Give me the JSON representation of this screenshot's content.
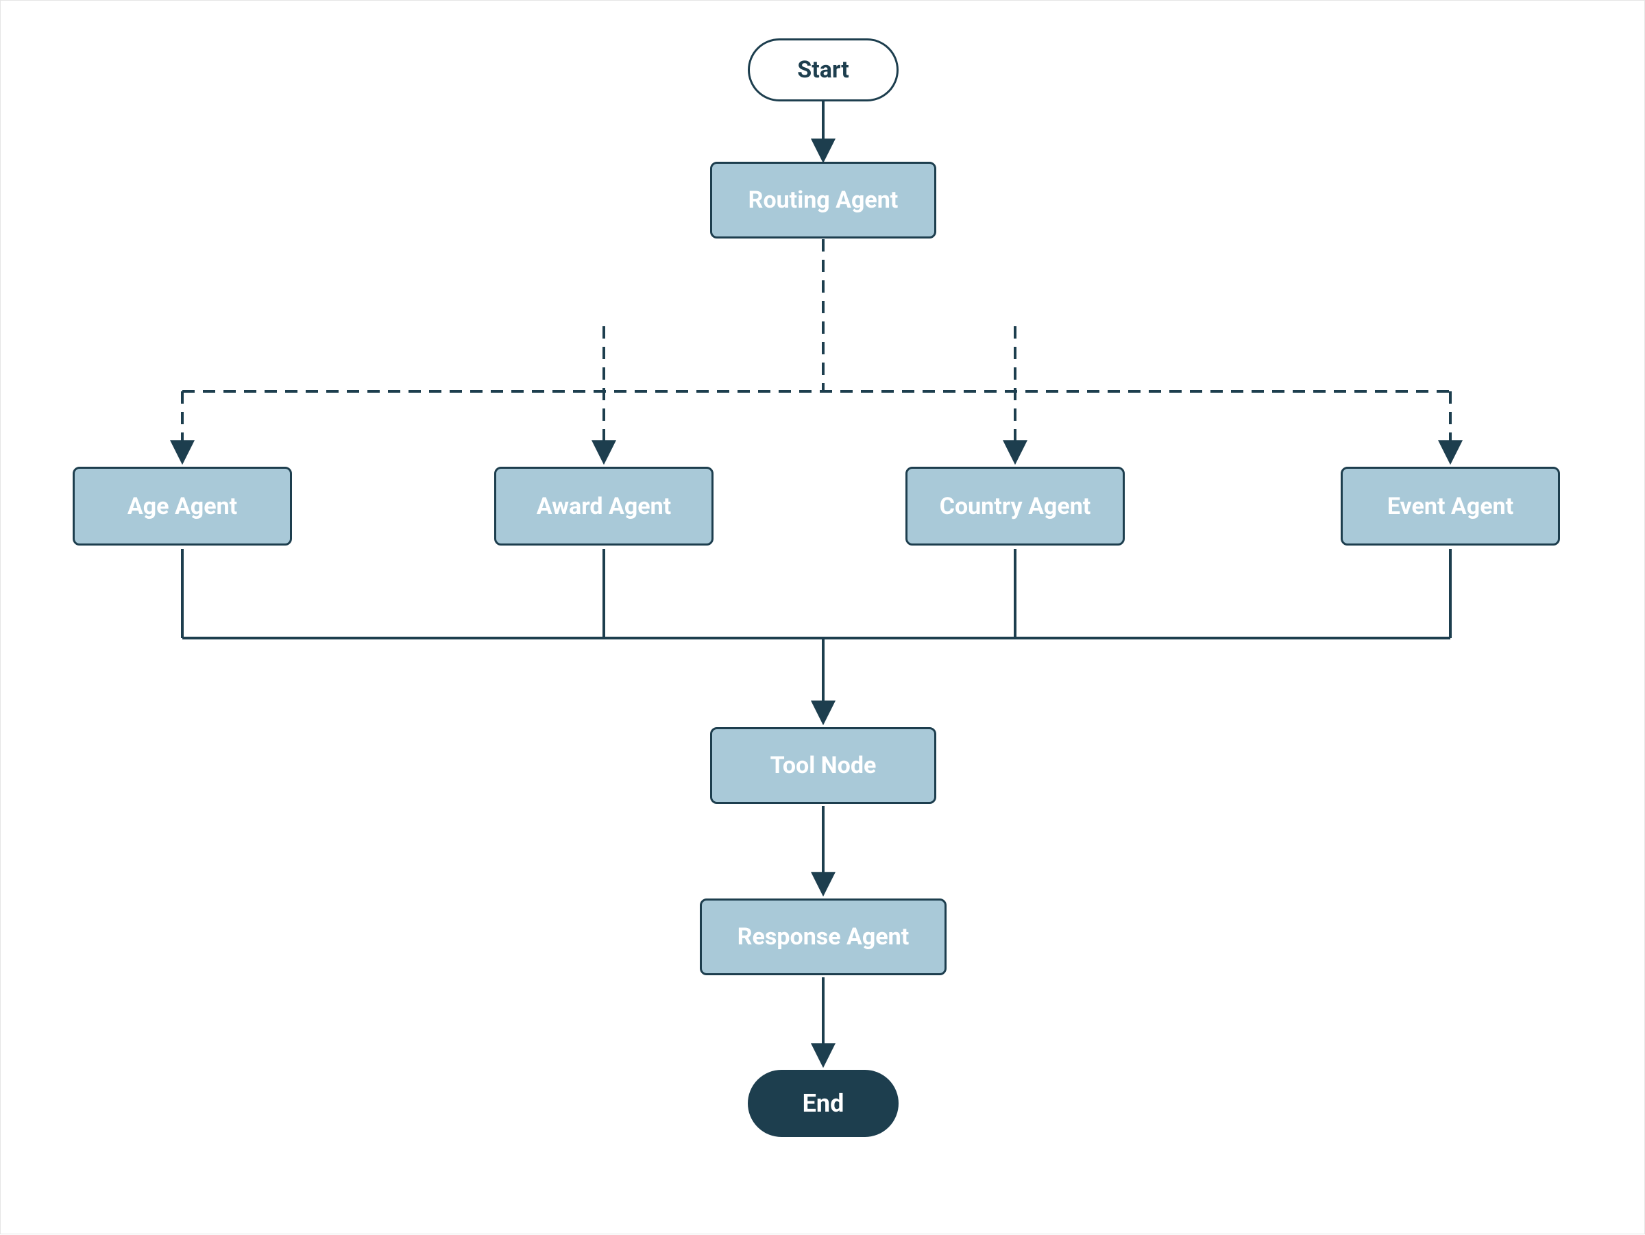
{
  "diagram": {
    "start": "Start",
    "routing": "Routing Agent",
    "age": "Age Agent",
    "award": "Award Agent",
    "country": "Country Agent",
    "event": "Event Agent",
    "tool": "Tool Node",
    "response": "Response  Agent",
    "end": "End"
  },
  "colors": {
    "stroke": "#1d3e4e",
    "node_fill": "#a9c9d8",
    "end_fill": "#1d3e4e",
    "node_text": "#ffffff"
  }
}
